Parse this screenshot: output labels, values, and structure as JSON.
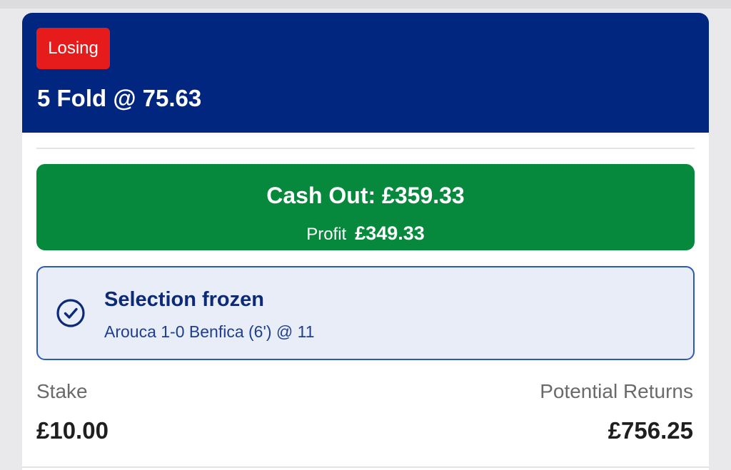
{
  "bet": {
    "status": "Losing",
    "title": "5 Fold @ 75.63"
  },
  "cash_out": {
    "label": "Cash Out: £359.33",
    "profit_label": "Profit",
    "profit_value": "£349.33"
  },
  "frozen_selection": {
    "title": "Selection frozen",
    "detail": "Arouca 1-0 Benfica (6') @ 11",
    "icon": "check-circle-icon"
  },
  "summary": {
    "stake_label": "Stake",
    "stake_value": "£10.00",
    "returns_label": "Potential Returns",
    "returns_value": "£756.25"
  },
  "colors": {
    "header_bg": "#00267f",
    "losing_badge": "#e61c1c",
    "cash_out_green": "#06893c",
    "frozen_panel_bg": "#e8edf8",
    "frozen_panel_border": "#2d5bb3"
  }
}
